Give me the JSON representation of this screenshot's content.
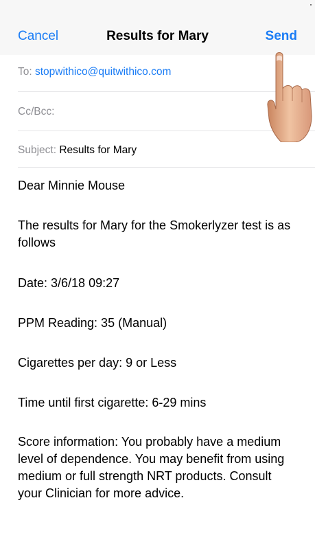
{
  "navbar": {
    "cancel_label": "Cancel",
    "title": "Results for Mary",
    "send_label": "Send"
  },
  "fields": {
    "to_label": "To:",
    "to_value": "stopwithico@quitwithico.com",
    "ccbcc_label": "Cc/Bcc:",
    "subject_label": "Subject:",
    "subject_value": "Results for Mary"
  },
  "message": {
    "greeting": "Dear Minnie Mouse",
    "intro": "The results for Mary for the Smokerlyzer test is as follows",
    "date": "Date: 3/6/18 09:27",
    "ppm": "PPM Reading: 35 (Manual)",
    "cigarettes": "Cigarettes per day: 9 or Less",
    "first_cigarette": "Time until first cigarette: 6-29 mins",
    "score": "Score information: You probably have a medium level of dependence. You may benefit from using medium or full strength NRT products. Consult your Clinician for more advice."
  },
  "icons": {
    "pointer": "hand-pointer-icon"
  },
  "colors": {
    "accent": "#1a7cf5",
    "navbar_bg": "#f7f7f7",
    "secondary_text": "#8e8e93"
  }
}
